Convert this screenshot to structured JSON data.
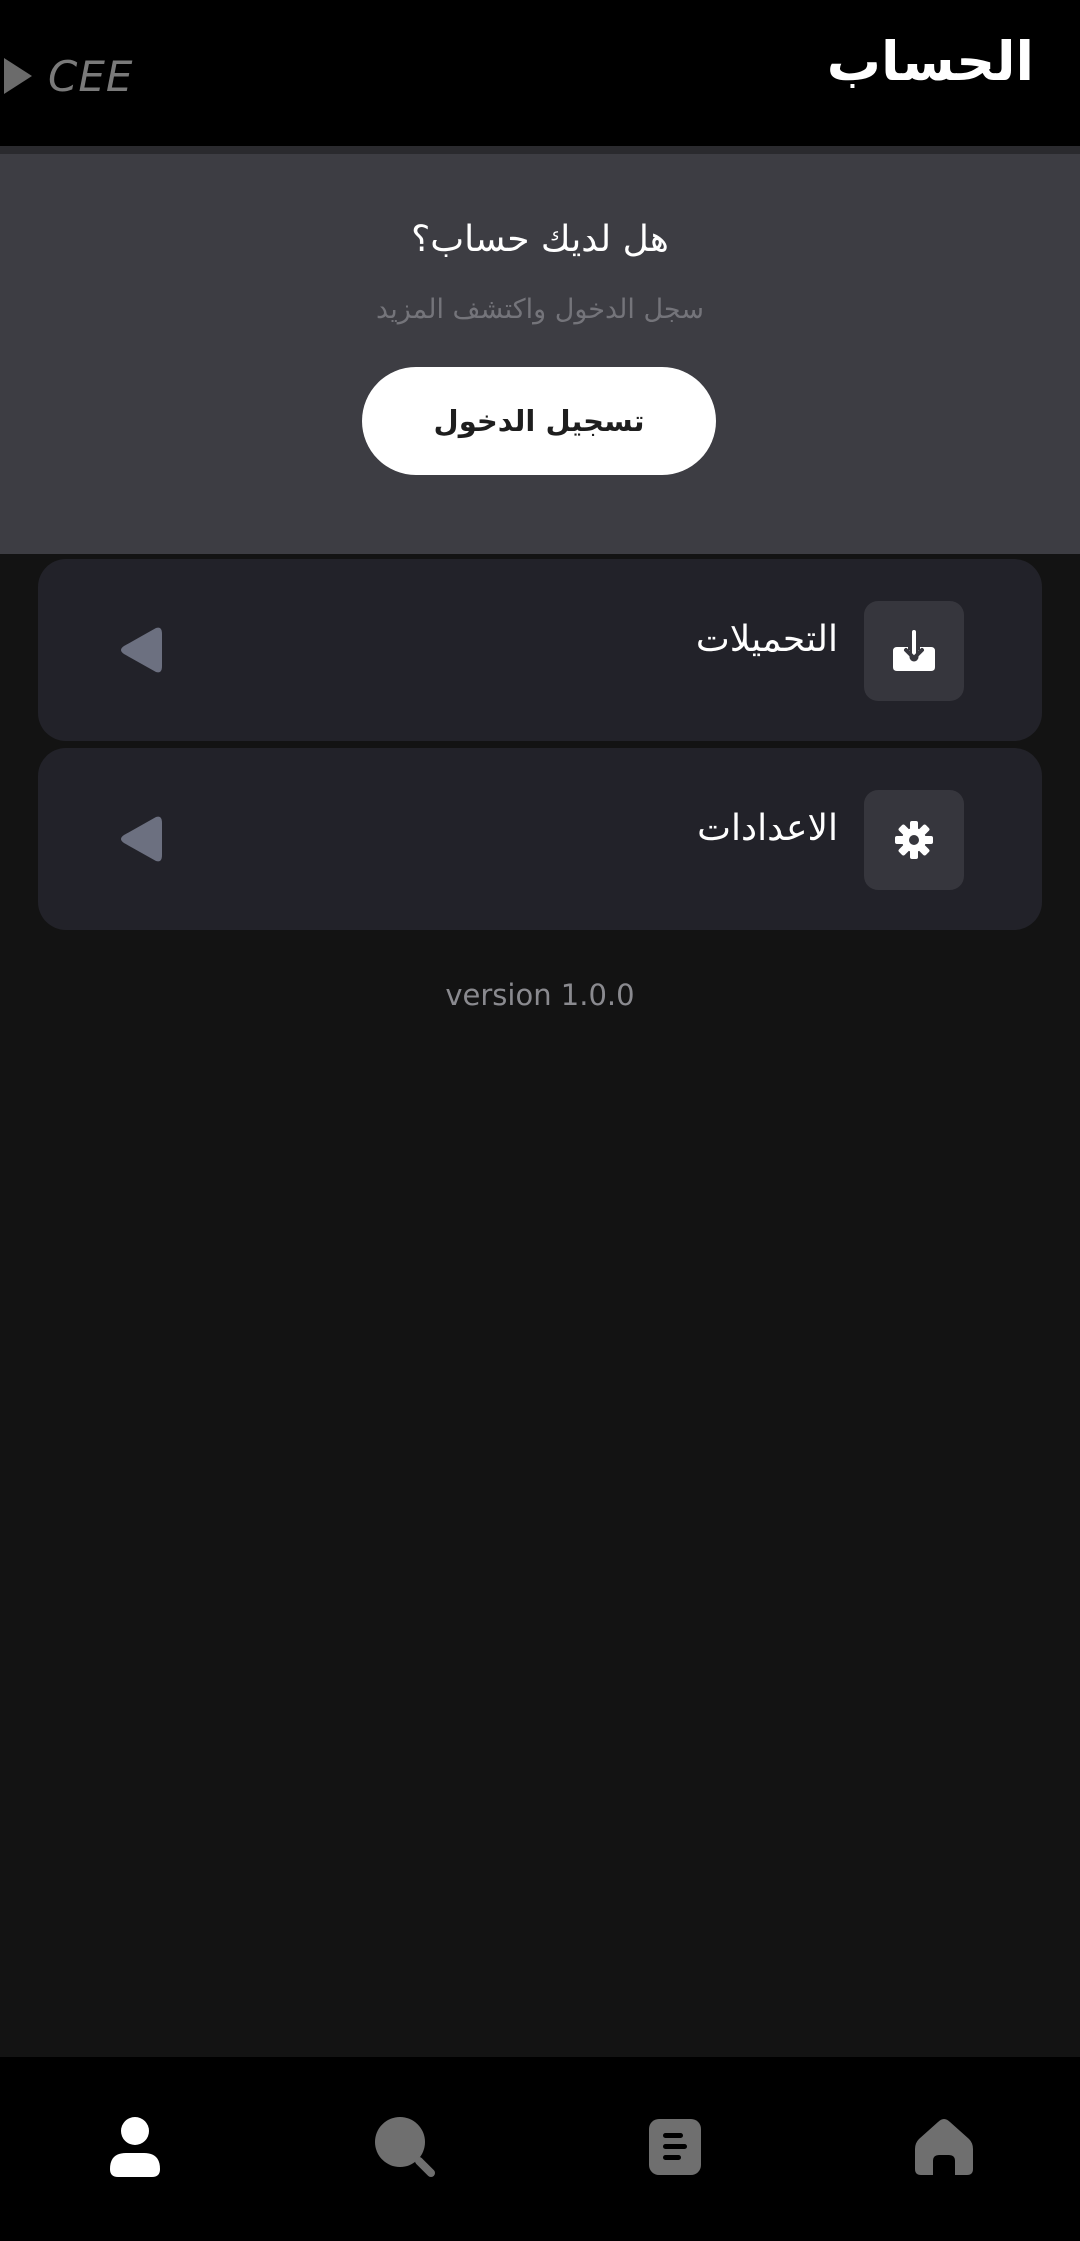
{
  "header": {
    "title": "الحساب",
    "brand": "CEE"
  },
  "login_prompt": {
    "question": "هل لديك حساب؟",
    "subtitle": "سجل الدخول واكتشف المزيد",
    "button_label": "تسجيل الدخول"
  },
  "menu": {
    "items": [
      {
        "label": "التحميلات",
        "icon": "download-icon"
      },
      {
        "label": "الاعدادات",
        "icon": "gear-icon"
      }
    ]
  },
  "footer": {
    "version": "version 1.0.0"
  },
  "bottom_nav": {
    "items": [
      {
        "icon": "profile-icon",
        "active": true
      },
      {
        "icon": "search-icon",
        "active": false
      },
      {
        "icon": "library-icon",
        "active": false
      },
      {
        "icon": "home-icon",
        "active": false
      }
    ]
  },
  "colors": {
    "header_bg": "#000000",
    "page_bg": "#131313",
    "login_card_bg": "#3d3d43",
    "menu_row_bg": "#222229",
    "icon_box_bg": "#36363d",
    "active_nav": "#ffffff",
    "inactive_nav": "#6f6f6f"
  }
}
